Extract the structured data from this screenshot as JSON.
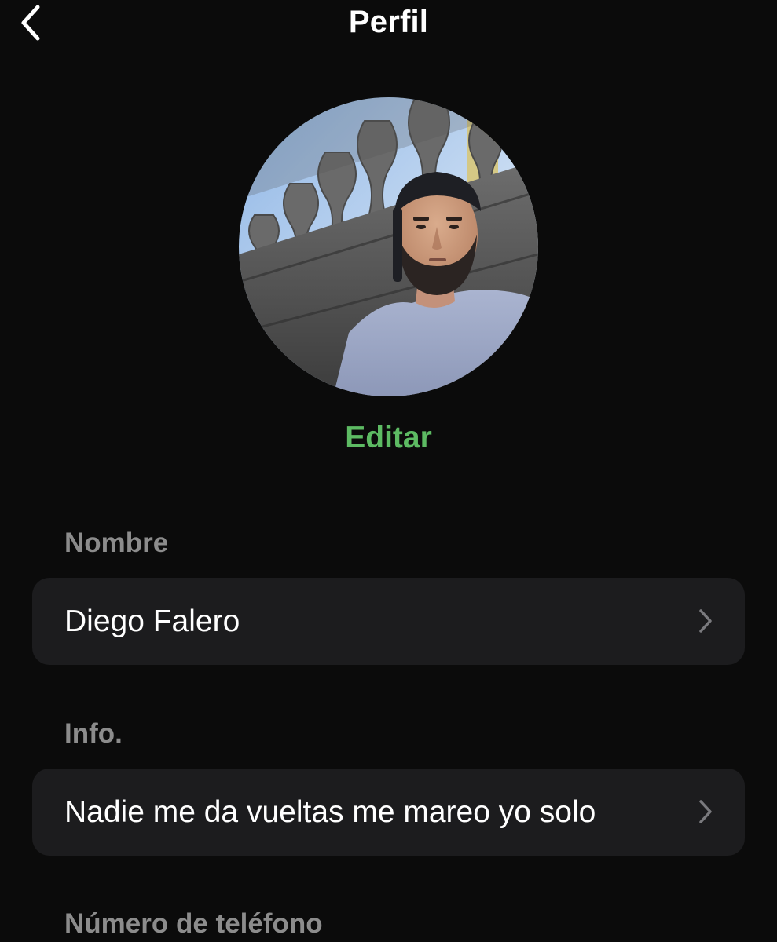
{
  "header": {
    "title": "Perfil",
    "back_icon": "chevron-left-icon"
  },
  "profile": {
    "photo": "profile-photo",
    "edit_label": "Editar",
    "edit_color": "#5dbb63"
  },
  "sections": {
    "name": {
      "label": "Nombre",
      "value": "Diego Falero",
      "chevron": "chevron-right-icon"
    },
    "info": {
      "label": "Info.",
      "value": "Nadie me da vueltas me mareo yo solo",
      "chevron": "chevron-right-icon"
    },
    "phone": {
      "label": "Número de teléfono"
    }
  },
  "colors": {
    "background": "#0b0b0b",
    "row_background": "#1c1c1e",
    "section_label": "#8c8c8c",
    "accent": "#5dbb63"
  }
}
